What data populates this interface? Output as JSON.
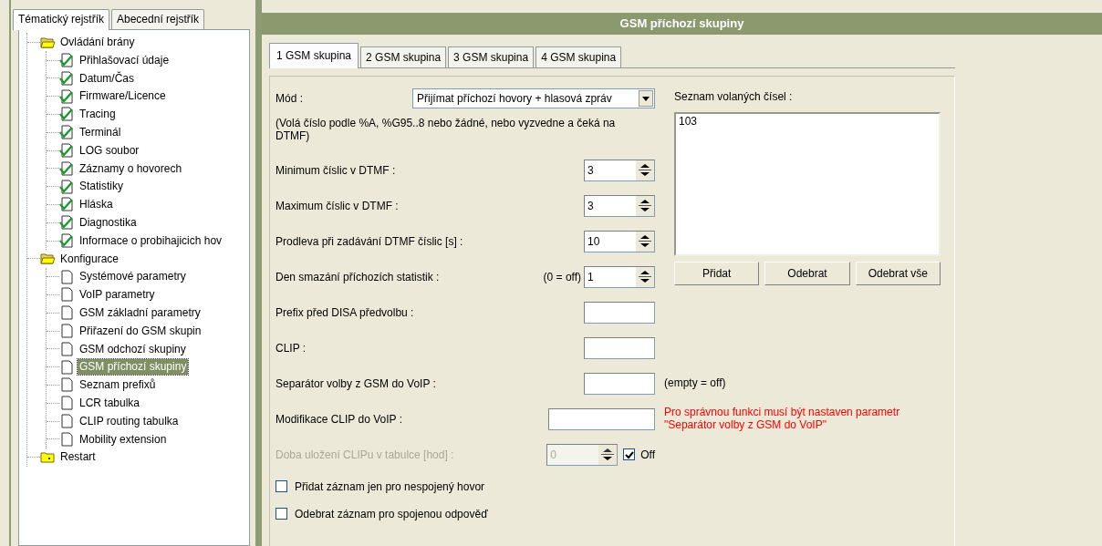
{
  "sidebar": {
    "tabs": [
      {
        "label": "Tématický rejstřík",
        "selected": true
      },
      {
        "label": "Abecední rejstřík",
        "selected": false
      }
    ],
    "tree": [
      {
        "label": "Ovládání brány",
        "kind": "folder",
        "expanded": true,
        "selected": false,
        "children": [
          {
            "label": "Přihlašovací údaje",
            "kind": "checked",
            "selected": false
          },
          {
            "label": "Datum/Čas",
            "kind": "checked",
            "selected": false
          },
          {
            "label": "Firmware/Licence",
            "kind": "checked",
            "selected": false
          },
          {
            "label": "Tracing",
            "kind": "checked",
            "selected": false
          },
          {
            "label": "Terminál",
            "kind": "checked",
            "selected": false
          },
          {
            "label": "LOG soubor",
            "kind": "checked",
            "selected": false
          },
          {
            "label": "Záznamy o hovorech",
            "kind": "checked",
            "selected": false
          },
          {
            "label": "Statistiky",
            "kind": "checked",
            "selected": false
          },
          {
            "label": "Hláska",
            "kind": "checked",
            "selected": false
          },
          {
            "label": "Diagnostika",
            "kind": "checked",
            "selected": false
          },
          {
            "label": "Informace o probihajicich hov",
            "kind": "checked",
            "selected": false
          }
        ]
      },
      {
        "label": "Konfigurace",
        "kind": "folder",
        "expanded": true,
        "selected": false,
        "children": [
          {
            "label": "Systémové parametry",
            "kind": "page",
            "selected": false
          },
          {
            "label": "VoIP parametry",
            "kind": "page",
            "selected": false
          },
          {
            "label": "GSM základní parametry",
            "kind": "page",
            "selected": false
          },
          {
            "label": "Přiřazení do GSM skupin",
            "kind": "page",
            "selected": false
          },
          {
            "label": "GSM odchozí skupiny",
            "kind": "page",
            "selected": false
          },
          {
            "label": "GSM příchozí skupiny",
            "kind": "page",
            "selected": true
          },
          {
            "label": "Seznam prefixů",
            "kind": "page",
            "selected": false
          },
          {
            "label": "LCR tabulka",
            "kind": "page",
            "selected": false
          },
          {
            "label": "CLIP routing tabulka",
            "kind": "page",
            "selected": false
          },
          {
            "label": "Mobility extension",
            "kind": "page",
            "selected": false
          }
        ]
      },
      {
        "label": "Restart",
        "kind": "folder",
        "expanded": false,
        "selected": false
      }
    ]
  },
  "header": {
    "title": "GSM příchozí skupiny"
  },
  "group_tabs": [
    {
      "label": "1 GSM skupina",
      "selected": true
    },
    {
      "label": "2 GSM skupina",
      "selected": false
    },
    {
      "label": "3 GSM skupina",
      "selected": false
    },
    {
      "label": "4 GSM skupina",
      "selected": false
    }
  ],
  "upper_fields": [
    {
      "kind": "select",
      "label": "Mód :",
      "value": "Přijímat příchozí hovory + hlasová zpráv"
    },
    {
      "kind": "note",
      "label": "(Volá číslo podle %A, %G95..8 nebo žádné, nebo vyzvedne a čeká na DTMF)"
    },
    {
      "kind": "spin",
      "label": "Minimum číslic v DTMF :",
      "value": "3"
    },
    {
      "kind": "spin",
      "label": "Maximum číslic v DTMF :",
      "value": "3"
    },
    {
      "kind": "spin",
      "label": "Prodleva při zadávání DTMF číslic [s] :",
      "value": "10"
    },
    {
      "kind": "spin",
      "label": "Den smazání příchozích statistik :",
      "hint": "(0 = off)",
      "value": "1"
    }
  ],
  "numbers_list": {
    "label": "Seznam volaných čísel :",
    "items": [
      "103"
    ],
    "buttons": [
      "Přidat",
      "Odebrat",
      "Odebrat vše"
    ]
  },
  "lower_fields": [
    {
      "kind": "text",
      "label": "Prefix před DISA předvolbu :",
      "disabled": false
    },
    {
      "kind": "text",
      "label": "CLIP :",
      "disabled": false
    },
    {
      "kind": "text",
      "label": "Separátor volby z GSM do VoIP :",
      "disabled": false,
      "note": {
        "text": "(empty = off)",
        "warning": false
      }
    },
    {
      "kind": "widetext",
      "label": "Modifikace CLIP do VoIP :",
      "disabled": false,
      "note": {
        "text": "Pro správnou funkci musí být nastaven parametr\n\"Separátor volby z GSM do VoIP\"",
        "warning": true
      }
    },
    {
      "kind": "spin",
      "label": "Doba uložení CLIPu v tabulce [hod] :",
      "value": "0",
      "disabled": true,
      "toggle": {
        "label": "Off",
        "checked": true
      }
    },
    {
      "kind": "checkbox",
      "label": "Přidat záznam jen pro nespojený hovor",
      "checked": false,
      "disabled": false
    },
    {
      "kind": "checkbox",
      "label": "Odebrat záznam pro spojenou odpověď",
      "checked": false,
      "disabled": false
    }
  ]
}
